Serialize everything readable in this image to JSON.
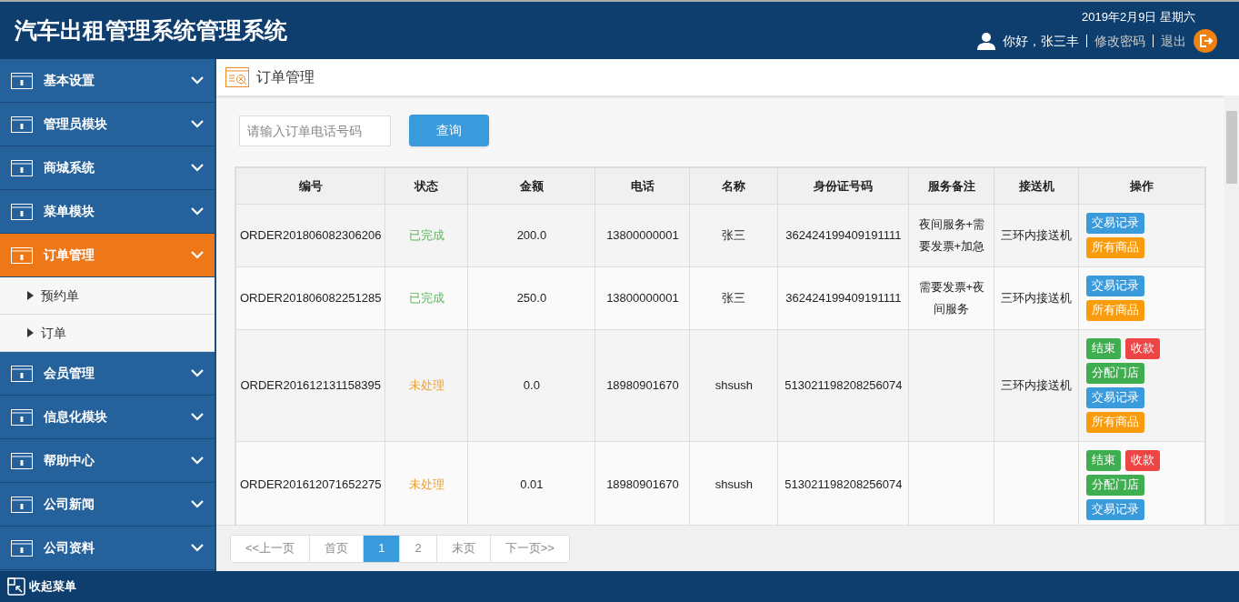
{
  "header": {
    "title": "汽车出租管理系统管理系统",
    "date": "2019年2月9日 星期六",
    "greeting": "你好，张三丰",
    "links": [
      "修改密码",
      "退出"
    ]
  },
  "sidebar": {
    "items": [
      {
        "label": "基本设置",
        "selected": false
      },
      {
        "label": "管理员模块",
        "selected": false
      },
      {
        "label": "商城系统",
        "selected": false
      },
      {
        "label": "菜单模块",
        "selected": false
      },
      {
        "label": "订单管理",
        "selected": true,
        "children": [
          {
            "label": "预约单"
          },
          {
            "label": "订单"
          }
        ]
      },
      {
        "label": "会员管理",
        "selected": false
      },
      {
        "label": "信息化模块",
        "selected": false
      },
      {
        "label": "帮助中心",
        "selected": false
      },
      {
        "label": "公司新闻",
        "selected": false
      },
      {
        "label": "公司资料",
        "selected": false
      }
    ],
    "collapse_label": "收起菜单"
  },
  "breadcrumb": "订单管理",
  "search": {
    "placeholder": "请输入订单电话号码",
    "button": "查询"
  },
  "table": {
    "columns": [
      "编号",
      "状态",
      "金额",
      "电话",
      "名称",
      "身份证号码",
      "服务备注",
      "接送机",
      "操作"
    ],
    "rows": [
      {
        "id": "ORDER201806082306206",
        "status": {
          "text": "已完成",
          "kind": "done"
        },
        "amount": "200.0",
        "phone": "13800000001",
        "name": "张三",
        "id_number": "362424199409191111",
        "note": "夜间服务+需要发票+加急",
        "pickup": "三环内接送机",
        "actions": [
          {
            "label": "交易记录",
            "kind": "log"
          },
          {
            "label": "所有商品",
            "kind": "goods"
          }
        ]
      },
      {
        "id": "ORDER201806082251285",
        "status": {
          "text": "已完成",
          "kind": "done"
        },
        "amount": "250.0",
        "phone": "13800000001",
        "name": "张三",
        "id_number": "362424199409191111",
        "note": "需要发票+夜间服务",
        "pickup": "三环内接送机",
        "actions": [
          {
            "label": "交易记录",
            "kind": "log"
          },
          {
            "label": "所有商品",
            "kind": "goods"
          }
        ]
      },
      {
        "id": "ORDER201612131158395",
        "status": {
          "text": "未处理",
          "kind": "pending"
        },
        "amount": "0.0",
        "phone": "18980901670",
        "name": "shsush",
        "id_number": "513021198208256074",
        "pickup": "三环内接送机",
        "actions": [
          {
            "label": "结束",
            "kind": "end"
          },
          {
            "label": "收款",
            "kind": "collect"
          },
          {
            "label": "分配门店",
            "kind": "assign"
          },
          {
            "label": "交易记录",
            "kind": "log"
          },
          {
            "label": "所有商品",
            "kind": "goods"
          }
        ]
      },
      {
        "id": "ORDER201612071652275",
        "status": {
          "text": "未处理",
          "kind": "pending"
        },
        "amount": "0.01",
        "phone": "18980901670",
        "name": "shsush",
        "id_number": "513021198208256074",
        "actions": [
          {
            "label": "结束",
            "kind": "end"
          },
          {
            "label": "收款",
            "kind": "collect"
          },
          {
            "label": "分配门店",
            "kind": "assign"
          },
          {
            "label": "交易记录",
            "kind": "log"
          }
        ]
      }
    ]
  },
  "pagination": [
    {
      "label": "<<上一页",
      "selected": false
    },
    {
      "label": "首页",
      "selected": false
    },
    {
      "label": "1",
      "selected": true
    },
    {
      "label": "2",
      "selected": false
    },
    {
      "label": "末页",
      "selected": false
    },
    {
      "label": "下一页>>",
      "selected": false
    }
  ]
}
